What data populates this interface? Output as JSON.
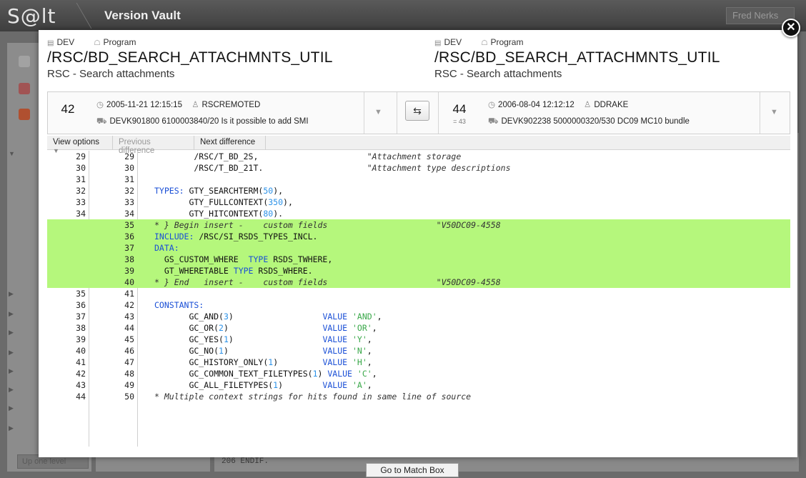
{
  "app": {
    "logo": "S@lt",
    "title": "Version Vault",
    "user": "Fred Nerks"
  },
  "background": {
    "up_level": "Up one level",
    "code_fragment": "206      ENDIF.",
    "go_to_match": "Go to Match Box"
  },
  "left": {
    "system": "DEV",
    "type": "Program",
    "object": "/RSC/BD_SEARCH_ATTACHMNTS_UTIL",
    "description": "RSC - Search attachments",
    "version": "42",
    "datetime": "2005-11-21 12:15:15",
    "user": "RSCREMOTED",
    "transport": "DEVK901800 6100003840/20 Is it possible to add SMI"
  },
  "right": {
    "system": "DEV",
    "type": "Program",
    "object": "/RSC/BD_SEARCH_ATTACHMNTS_UTIL",
    "description": "RSC - Search attachments",
    "version": "44",
    "version_sub": "= 43",
    "datetime": "2006-08-04 12:12:12",
    "user": "DDRAKE",
    "transport": "DEVK902238 5000000320/530 DC09 MC10 bundle"
  },
  "toolbar": {
    "view_options": "View options",
    "previous_difference": "Previous difference",
    "next_difference": "Next difference"
  },
  "code_lines": [
    {
      "l": "29",
      "r": "29",
      "ins": false,
      "parts": [
        [
          "t",
          "        /RSC/T_BD_2S,                      "
        ],
        [
          "c",
          "\"Attachment storage"
        ]
      ]
    },
    {
      "l": "30",
      "r": "30",
      "ins": false,
      "parts": [
        [
          "t",
          "        /RSC/T_BD_21T.                     "
        ],
        [
          "c",
          "\"Attachment type descriptions"
        ]
      ]
    },
    {
      "l": "31",
      "r": "31",
      "ins": false,
      "parts": []
    },
    {
      "l": "32",
      "r": "32",
      "ins": false,
      "parts": [
        [
          "k",
          "TYPES:"
        ],
        [
          "t",
          " GTY_SEARCHTERM("
        ],
        [
          "n",
          "50"
        ],
        [
          "t",
          "),"
        ]
      ]
    },
    {
      "l": "33",
      "r": "33",
      "ins": false,
      "parts": [
        [
          "t",
          "       GTY_FULLCONTEXT("
        ],
        [
          "n",
          "350"
        ],
        [
          "t",
          "),"
        ]
      ]
    },
    {
      "l": "34",
      "r": "34",
      "ins": false,
      "parts": [
        [
          "t",
          "       GTY_HITCONTEXT("
        ],
        [
          "n",
          "80"
        ],
        [
          "t",
          ")."
        ]
      ]
    },
    {
      "l": "",
      "r": "35",
      "ins": true,
      "parts": [
        [
          "c",
          "* } Begin insert -    custom fields                      \"V50DC09-4558"
        ]
      ]
    },
    {
      "l": "",
      "r": "36",
      "ins": true,
      "parts": [
        [
          "k",
          "INCLUDE:"
        ],
        [
          "t",
          " /RSC/SI_RSDS_TYPES_INCL."
        ]
      ]
    },
    {
      "l": "",
      "r": "37",
      "ins": true,
      "parts": [
        [
          "k",
          "DATA:"
        ]
      ]
    },
    {
      "l": "",
      "r": "38",
      "ins": true,
      "parts": [
        [
          "t",
          "  GS_CUSTOM_WHERE  "
        ],
        [
          "k",
          "TYPE"
        ],
        [
          "t",
          " RSDS_TWHERE,"
        ]
      ]
    },
    {
      "l": "",
      "r": "39",
      "ins": true,
      "parts": [
        [
          "t",
          "  GT_WHERETABLE "
        ],
        [
          "k",
          "TYPE"
        ],
        [
          "t",
          " RSDS_WHERE."
        ]
      ]
    },
    {
      "l": "",
      "r": "40",
      "ins": true,
      "parts": [
        [
          "c",
          "* } End   insert -    custom fields                      \"V50DC09-4558"
        ]
      ]
    },
    {
      "l": "35",
      "r": "41",
      "ins": false,
      "parts": []
    },
    {
      "l": "36",
      "r": "42",
      "ins": false,
      "parts": [
        [
          "k",
          "CONSTANTS:"
        ]
      ]
    },
    {
      "l": "37",
      "r": "43",
      "ins": false,
      "parts": [
        [
          "t",
          "       GC_AND("
        ],
        [
          "n",
          "3"
        ],
        [
          "t",
          ")                  "
        ],
        [
          "k",
          "VALUE"
        ],
        [
          "t",
          " "
        ],
        [
          "s",
          "'AND'"
        ],
        [
          "t",
          ","
        ]
      ]
    },
    {
      "l": "38",
      "r": "44",
      "ins": false,
      "parts": [
        [
          "t",
          "       GC_OR("
        ],
        [
          "n",
          "2"
        ],
        [
          "t",
          ")                   "
        ],
        [
          "k",
          "VALUE"
        ],
        [
          "t",
          " "
        ],
        [
          "s",
          "'OR'"
        ],
        [
          "t",
          ","
        ]
      ]
    },
    {
      "l": "39",
      "r": "45",
      "ins": false,
      "parts": [
        [
          "t",
          "       GC_YES("
        ],
        [
          "n",
          "1"
        ],
        [
          "t",
          ")                  "
        ],
        [
          "k",
          "VALUE"
        ],
        [
          "t",
          " "
        ],
        [
          "s",
          "'Y'"
        ],
        [
          "t",
          ","
        ]
      ]
    },
    {
      "l": "40",
      "r": "46",
      "ins": false,
      "parts": [
        [
          "t",
          "       GC_NO("
        ],
        [
          "n",
          "1"
        ],
        [
          "t",
          ")                   "
        ],
        [
          "k",
          "VALUE"
        ],
        [
          "t",
          " "
        ],
        [
          "s",
          "'N'"
        ],
        [
          "t",
          ","
        ]
      ]
    },
    {
      "l": "41",
      "r": "47",
      "ins": false,
      "parts": [
        [
          "t",
          "       GC_HISTORY_ONLY("
        ],
        [
          "n",
          "1"
        ],
        [
          "t",
          ")         "
        ],
        [
          "k",
          "VALUE"
        ],
        [
          "t",
          " "
        ],
        [
          "s",
          "'H'"
        ],
        [
          "t",
          ","
        ]
      ]
    },
    {
      "l": "42",
      "r": "48",
      "ins": false,
      "parts": [
        [
          "t",
          "       GC_COMMON_TEXT_FILETYPES("
        ],
        [
          "n",
          "1"
        ],
        [
          "t",
          ") "
        ],
        [
          "k",
          "VALUE"
        ],
        [
          "t",
          " "
        ],
        [
          "s",
          "'C'"
        ],
        [
          "t",
          ","
        ]
      ]
    },
    {
      "l": "43",
      "r": "49",
      "ins": false,
      "parts": [
        [
          "t",
          "       GC_ALL_FILETYPES("
        ],
        [
          "n",
          "1"
        ],
        [
          "t",
          ")        "
        ],
        [
          "k",
          "VALUE"
        ],
        [
          "t",
          " "
        ],
        [
          "s",
          "'A'"
        ],
        [
          "t",
          ","
        ]
      ]
    },
    {
      "l": "44",
      "r": "50",
      "ins": false,
      "parts": [
        [
          "c",
          "* Multiple context strings for hits found in same line of source"
        ]
      ]
    }
  ],
  "colors": {
    "insert_bg": "#b5f77c",
    "keyword": "#1a4fd6",
    "number": "#2c92e8",
    "string": "#3aa84a"
  }
}
